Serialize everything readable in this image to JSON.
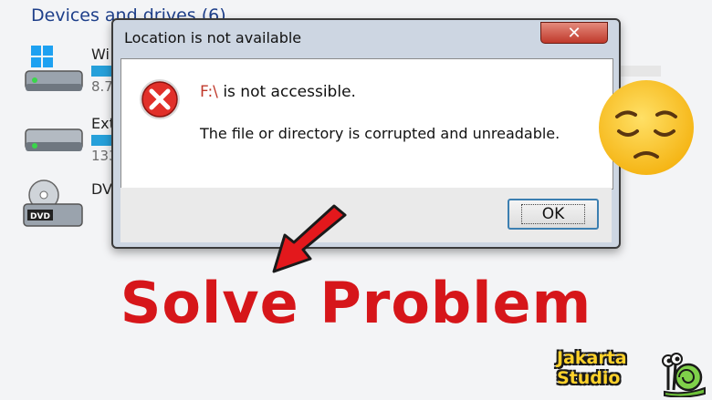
{
  "explorer": {
    "section_header": "Devices and drives (6)",
    "drives": [
      {
        "name": "Wi",
        "size": "8.7"
      },
      {
        "name": "Ext",
        "size": "133"
      },
      {
        "name": "DV",
        "size": ""
      }
    ],
    "dvd_label": "DVD"
  },
  "dialog": {
    "title": "Location is not available",
    "close_label": "✕",
    "drive": "F:\\",
    "message_suffix": " is not accessible.",
    "detail": "The file or directory is corrupted and unreadable.",
    "ok_label": "OK",
    "error_icon": "error-x-icon"
  },
  "overlay": {
    "headline": "Solve Problem",
    "emoji": "sad-face-emoji",
    "arrow": "red-arrow-icon",
    "logo_line1": "Jakarta",
    "logo_line2": "Studio"
  },
  "colors": {
    "headline": "#d6161a",
    "accent": "#26a0da",
    "header_text": "#1e3f8a",
    "logo_text": "#ffd22b"
  }
}
